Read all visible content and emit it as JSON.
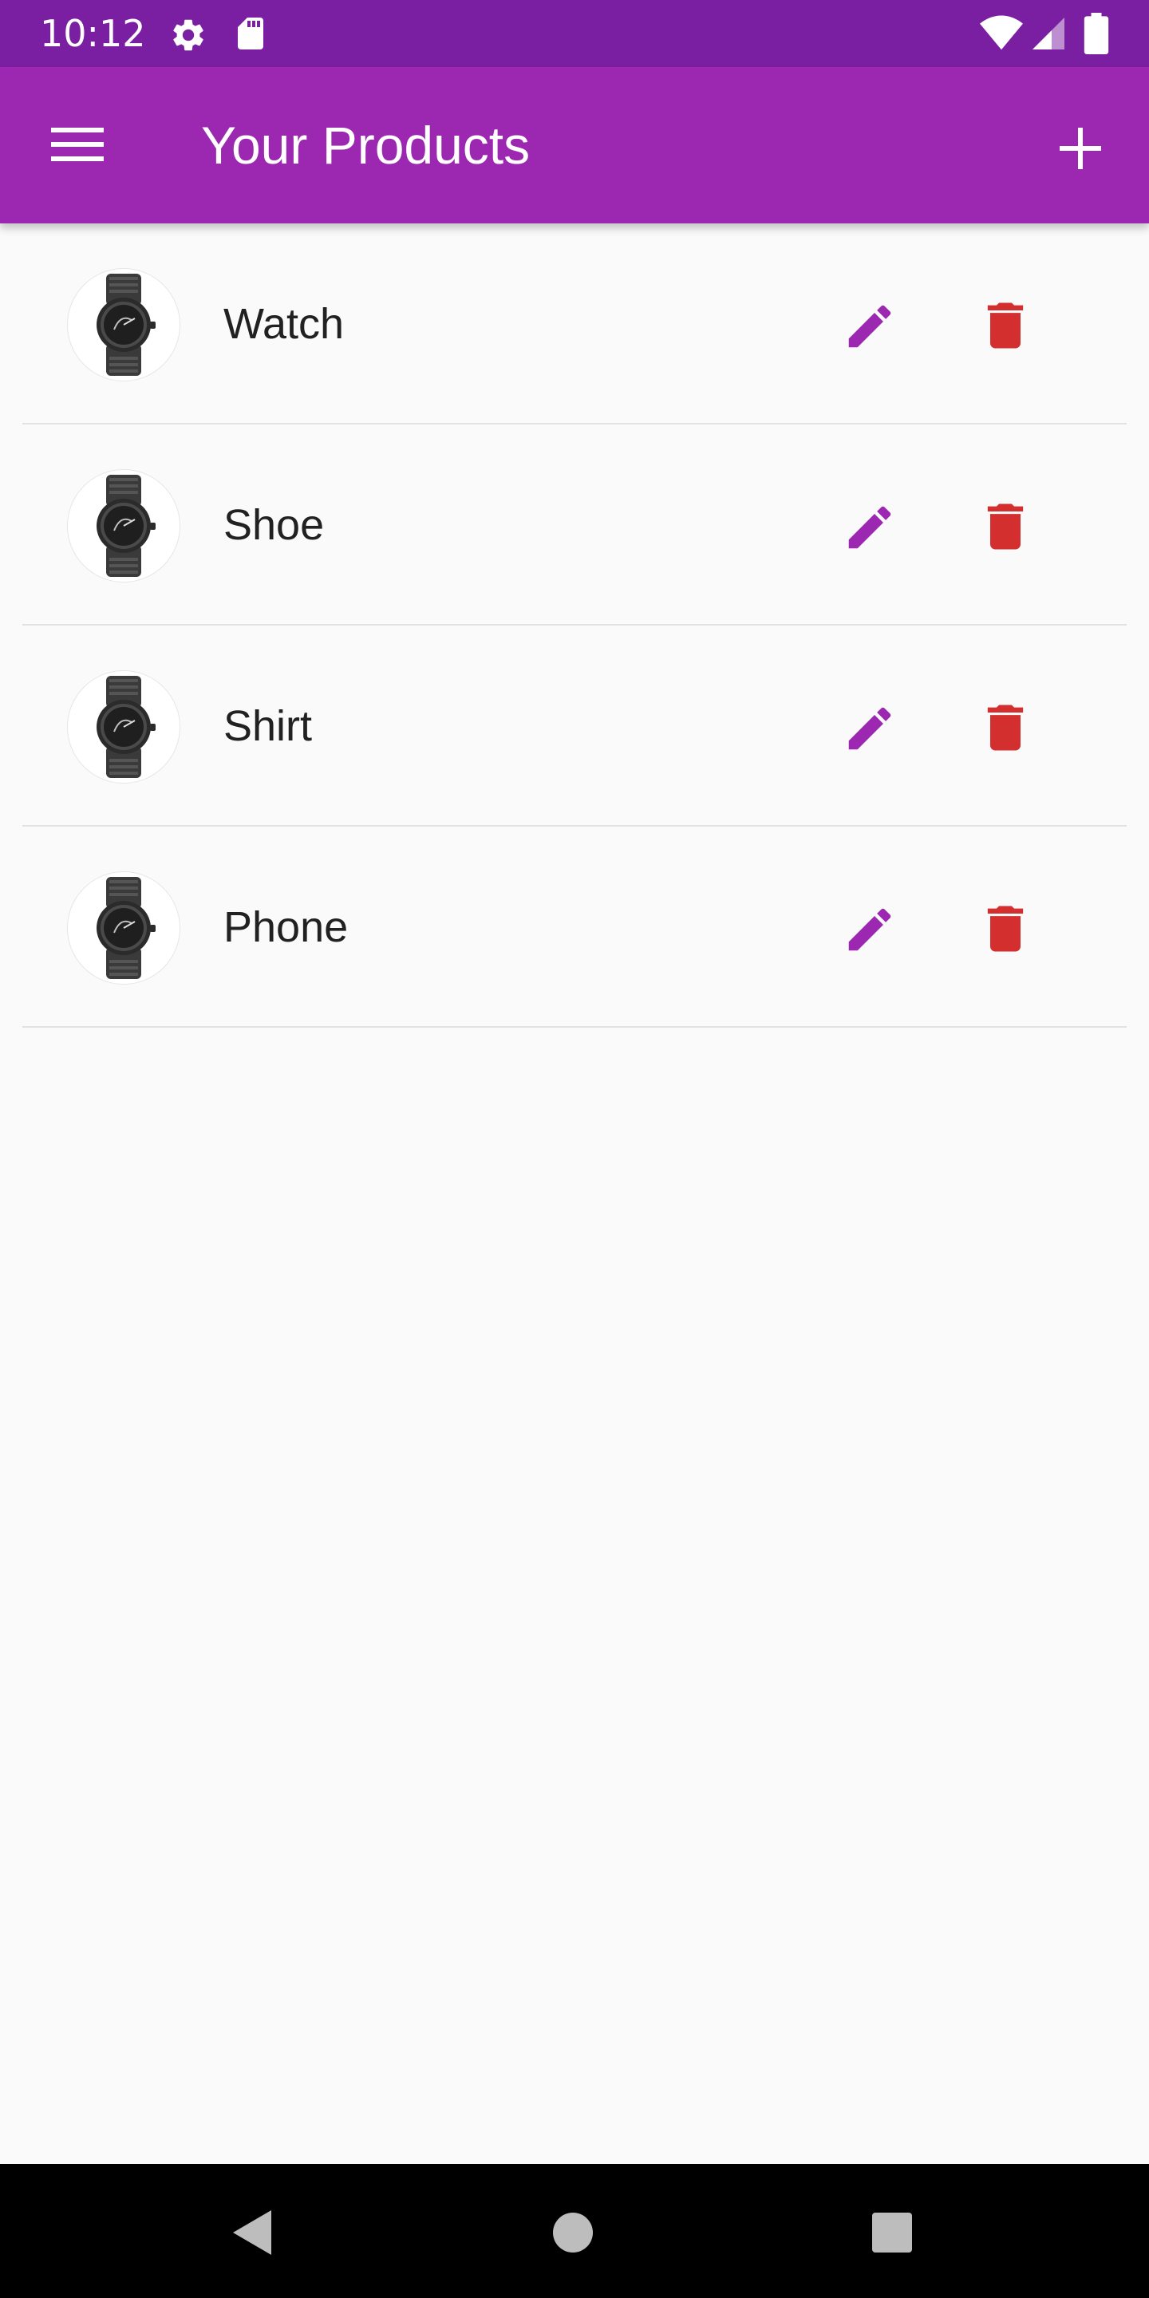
{
  "status_bar": {
    "time": "10:12",
    "left_icons": [
      "gear-icon",
      "sd-card-icon"
    ],
    "right_icons": [
      "wifi-icon",
      "cell-signal-icon",
      "battery-icon"
    ]
  },
  "app_bar": {
    "title": "Your Products",
    "menu_icon": "hamburger-menu-icon",
    "add_icon": "plus-icon",
    "color": "#9c27b0"
  },
  "products": [
    {
      "title": "Watch",
      "image": "watch-image"
    },
    {
      "title": "Shoe",
      "image": "watch-image"
    },
    {
      "title": "Shirt",
      "image": "watch-image"
    },
    {
      "title": "Phone",
      "image": "watch-image"
    }
  ],
  "actions": {
    "edit_icon": "pencil-icon",
    "edit_color": "#9c27b0",
    "delete_icon": "trash-icon",
    "delete_color": "#d32f2f"
  },
  "nav_bar": {
    "icons": [
      "back-triangle-icon",
      "home-circle-icon",
      "recents-square-icon"
    ]
  }
}
